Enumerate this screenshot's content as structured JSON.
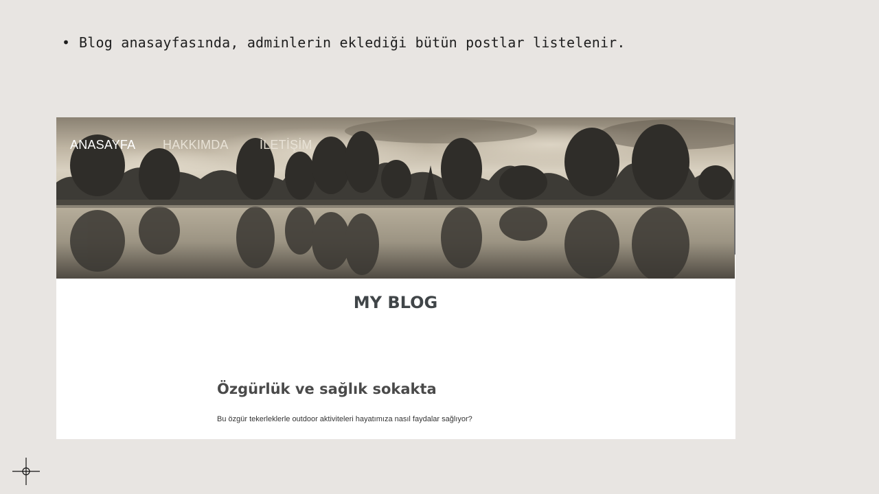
{
  "slide": {
    "bullet_symbol": "•",
    "bullet_text": "Blog anasayfasında, adminlerin eklediği bütün postlar listelenir."
  },
  "blog": {
    "nav": {
      "items": [
        {
          "label": "ANASAYFA"
        },
        {
          "label": "HAKKIMDA"
        },
        {
          "label": "İLETİŞİM"
        }
      ]
    },
    "title": "MY BLOG",
    "posts": [
      {
        "title": "Özgürlük ve sağlık sokakta",
        "subtitle": "Bu özgür tekerleklerle outdoor aktiviteleri hayatımıza nasıl faydalar sağlıyor?"
      }
    ]
  },
  "colors": {
    "slide_background": "#e8e5e2",
    "text_dark": "#1e1e1e",
    "blog_title": "#404548",
    "post_title": "#4a4a4a"
  },
  "icons": {
    "cursor": "crosshair-cursor-icon",
    "hero": "lake-trees-reflection-image"
  }
}
